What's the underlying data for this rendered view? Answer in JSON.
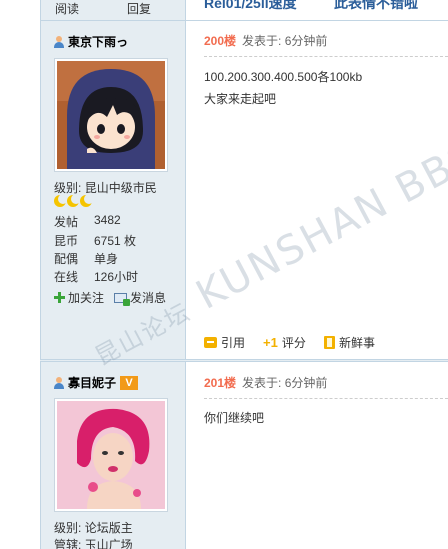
{
  "top": {
    "stat1_label": "阅读",
    "stat2_label": "回复",
    "title_fragment": "Rel01/25ll速度",
    "title_fragment2": "此表情不错啦"
  },
  "posts": [
    {
      "author": "東京下雨っ",
      "level_label": "级别:",
      "level_value": "昆山中级市民",
      "stats": [
        {
          "key": "发帖",
          "value": "3482"
        },
        {
          "key": "昆币",
          "value": "6751 枚"
        },
        {
          "key": "配偶",
          "value": "单身"
        },
        {
          "key": "在线",
          "value": "126小时"
        }
      ],
      "follow_label": "加关注",
      "message_label": "发消息",
      "floor": "200楼",
      "posted_at": "发表于: 6分钟前",
      "content": [
        "100.200.300.400.500各100kb",
        "大家来走起吧"
      ],
      "actions": {
        "quote": "引用",
        "rate": "评分",
        "rate_icon_text": "+1",
        "news": "新鲜事"
      }
    },
    {
      "author": "寡目妮子",
      "badge": "V",
      "level_label": "级别:",
      "level_value": "论坛版主",
      "extra_line": "管辖: 玉山广场",
      "floor": "201楼",
      "posted_at": "发表于: 6分钟前",
      "content": [
        "你们继续吧"
      ]
    }
  ],
  "watermark": {
    "text_cn": "昆山论坛",
    "text_en": "KUNSHAN BBS"
  },
  "colors": {
    "sidebar": "#e5edf2",
    "border": "#c2d5e3",
    "floor": "#f26c4f",
    "link": "#2b5e9a",
    "accent_icon": "#f3b100"
  }
}
